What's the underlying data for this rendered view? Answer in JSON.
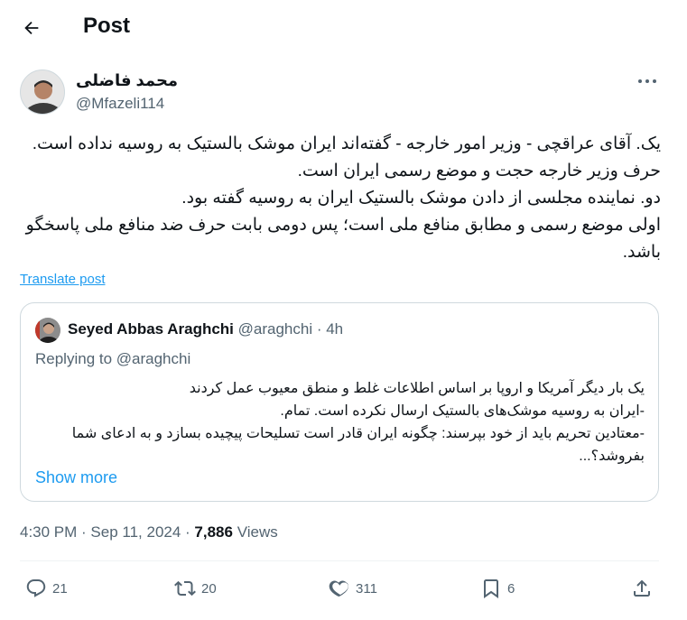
{
  "header": {
    "title": "Post",
    "back_icon": "arrow-left-icon"
  },
  "author": {
    "name": "محمد فاضلی",
    "handle": "@Mfazeli114"
  },
  "tweet": {
    "text": "یک. آقای عراقچی - وزیر امور خارجه - گفته‌اند ایران موشک بالستیک به روسیه نداده است. حرف وزیر خارجه حجت و موضع رسمی ایران است.\nدو. نماینده مجلسی از دادن موشک بالستیک ایران به روسیه گفته بود.\nاولی موضع رسمی و مطابق منافع ملی است؛ پس دومی بابت حرف ضد منافع ملی پاسخگو باشد.",
    "translate_label": "Translate post"
  },
  "quote": {
    "name": "Seyed Abbas Araghchi",
    "handle": "@araghchi",
    "separator": " · ",
    "time": "4h",
    "replying": "Replying to @araghchi",
    "text": "یک بار دیگر آمریکا و اروپا بر اساس اطلاعات غلط و منطق معیوب عمل کردند\n-ایران به روسیه موشک‌های بالستیک ارسال نکرده است. تمام.\n-معتادین تحریم باید از خود بپرسند: چگونه ایران قادر است تسلیحات پیچیده بسازد و به ادعای شما بفروشد؟...",
    "show_more": "Show more"
  },
  "meta": {
    "time": "4:30 PM",
    "separator": " · ",
    "date": "Sep 11, 2024",
    "separator2": " · ",
    "views_count": "7,886",
    "views_label": " Views"
  },
  "actions": {
    "reply": "21",
    "retweet": "20",
    "like": "311",
    "bookmark": "6"
  },
  "colors": {
    "accent": "#1d9bf0",
    "secondary_text": "#536471",
    "border": "#cfd9de"
  }
}
